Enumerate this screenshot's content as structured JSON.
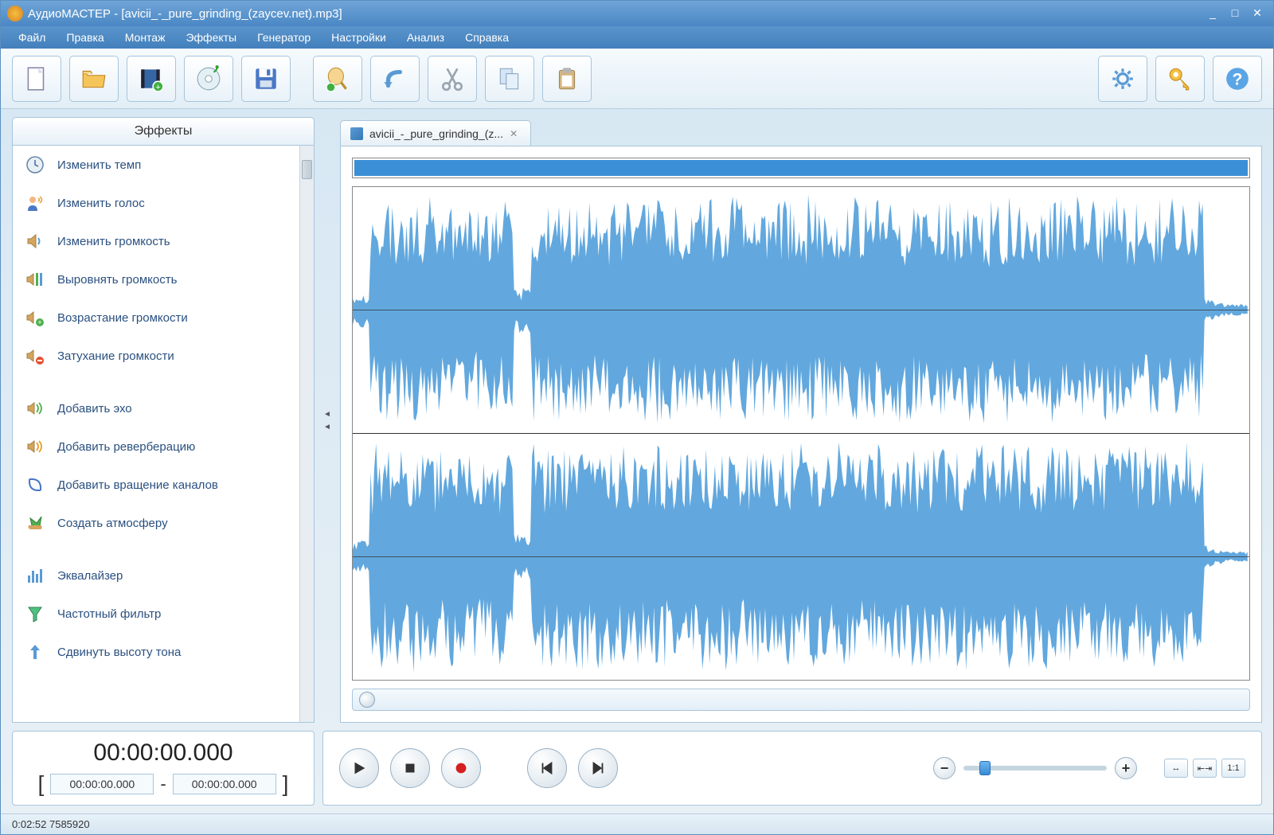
{
  "window": {
    "title": "АудиоМАСТЕР - [avicii_-_pure_grinding_(zaycev.net).mp3]"
  },
  "menu": [
    "Файл",
    "Правка",
    "Монтаж",
    "Эффекты",
    "Генератор",
    "Настройки",
    "Анализ",
    "Справка"
  ],
  "toolbar": {
    "new": "new",
    "open": "open",
    "video": "video",
    "cd": "cd",
    "save": "save",
    "mixer": "mixer",
    "undo": "undo",
    "cut": "cut",
    "copy": "copy",
    "paste": "paste",
    "settings": "settings",
    "key": "key",
    "help": "help"
  },
  "sidebar": {
    "title": "Эффекты",
    "groups": [
      [
        "Изменить темп",
        "Изменить голос",
        "Изменить громкость",
        "Выровнять громкость",
        "Возрастание громкости",
        "Затухание громкости"
      ],
      [
        "Добавить эхо",
        "Добавить реверберацию",
        "Добавить вращение каналов",
        "Создать атмосферу"
      ],
      [
        "Эквалайзер",
        "Частотный фильтр",
        "Сдвинуть высоту тона"
      ]
    ]
  },
  "tab": {
    "label": "avicii_-_pure_grinding_(z..."
  },
  "time": {
    "main": "00:00:00.000",
    "start": "00:00:00.000",
    "end": "00:00:00.000",
    "sep": "-"
  },
  "zoom_extra": {
    "fit": "↔",
    "sel": "⇤⇥",
    "one": "1:1"
  },
  "status": "0:02:52 7585920"
}
